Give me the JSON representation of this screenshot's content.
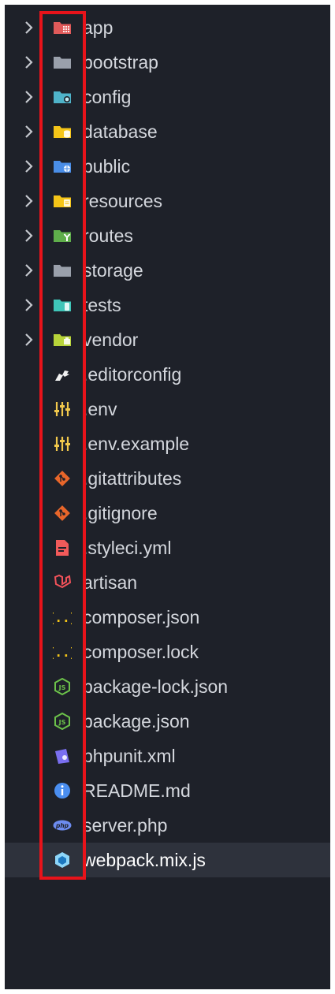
{
  "explorer": {
    "items": [
      {
        "label": "app",
        "kind": "folder",
        "icon": "folder-app-icon",
        "color": "#e05a5a"
      },
      {
        "label": "bootstrap",
        "kind": "folder",
        "icon": "folder-icon",
        "color": "#9aa0ab"
      },
      {
        "label": "config",
        "kind": "folder",
        "icon": "folder-config-icon",
        "color": "#4fb3c9"
      },
      {
        "label": "database",
        "kind": "folder",
        "icon": "folder-database-icon",
        "color": "#f5c518"
      },
      {
        "label": "public",
        "kind": "folder",
        "icon": "folder-public-icon",
        "color": "#4a8ee8"
      },
      {
        "label": "resources",
        "kind": "folder",
        "icon": "folder-resources-icon",
        "color": "#f5c518"
      },
      {
        "label": "routes",
        "kind": "folder",
        "icon": "folder-routes-icon",
        "color": "#5fae4b"
      },
      {
        "label": "storage",
        "kind": "folder",
        "icon": "folder-icon",
        "color": "#9aa0ab"
      },
      {
        "label": "tests",
        "kind": "folder",
        "icon": "folder-tests-icon",
        "color": "#3fc5b8"
      },
      {
        "label": "vendor",
        "kind": "folder",
        "icon": "folder-vendor-icon",
        "color": "#b8d43a"
      },
      {
        "label": ".editorconfig",
        "kind": "file",
        "icon": "editorconfig-icon",
        "color": "#f2f2f2"
      },
      {
        "label": ".env",
        "kind": "file",
        "icon": "env-settings-icon",
        "color": "#f2c94c"
      },
      {
        "label": ".env.example",
        "kind": "file",
        "icon": "env-settings-icon",
        "color": "#f2c94c"
      },
      {
        "label": ".gitattributes",
        "kind": "file",
        "icon": "git-icon",
        "color": "#e8662a"
      },
      {
        "label": ".gitignore",
        "kind": "file",
        "icon": "git-icon",
        "color": "#e8662a"
      },
      {
        "label": ".styleci.yml",
        "kind": "file",
        "icon": "yaml-file-icon",
        "color": "#f25a5a"
      },
      {
        "label": "artisan",
        "kind": "file",
        "icon": "laravel-icon",
        "color": "#f2525a"
      },
      {
        "label": "composer.json",
        "kind": "file",
        "icon": "json-braces-icon",
        "color": "#f5c518"
      },
      {
        "label": "composer.lock",
        "kind": "file",
        "icon": "json-braces-icon",
        "color": "#f5c518"
      },
      {
        "label": "package-lock.json",
        "kind": "file",
        "icon": "nodejs-icon",
        "color": "#6cc24a"
      },
      {
        "label": "package.json",
        "kind": "file",
        "icon": "nodejs-icon",
        "color": "#6cc24a"
      },
      {
        "label": "phpunit.xml",
        "kind": "file",
        "icon": "phpunit-icon",
        "color": "#7a6ff0"
      },
      {
        "label": "README.md",
        "kind": "file",
        "icon": "info-icon",
        "color": "#4a8ef0"
      },
      {
        "label": "server.php",
        "kind": "file",
        "icon": "php-icon",
        "color": "#6d8cf0"
      },
      {
        "label": "webpack.mix.js",
        "kind": "file",
        "icon": "webpack-icon",
        "color": "#8dd6f9",
        "selected": true
      }
    ]
  },
  "colors": {
    "background": "#1e2129",
    "selected_row": "#2e323c",
    "text": "#d4d7dd",
    "annotation_box": "#e8131a"
  }
}
